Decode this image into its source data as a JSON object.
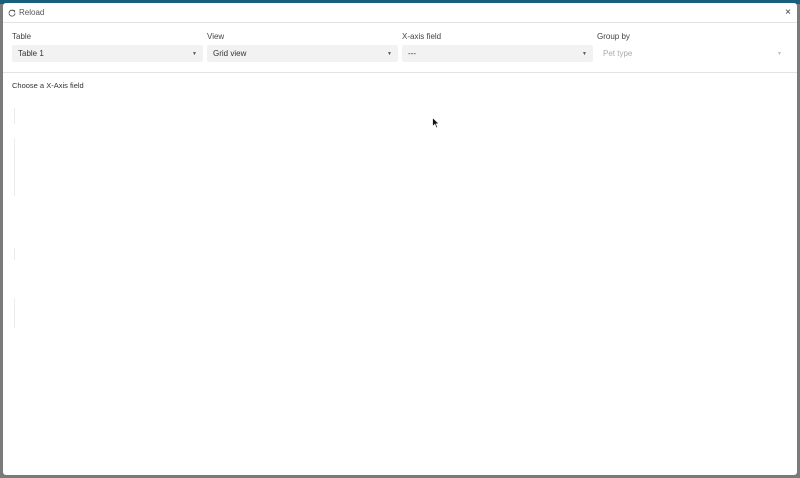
{
  "window": {
    "reload_label": "Reload",
    "close_glyph": "×"
  },
  "controls": [
    {
      "label": "Table",
      "value": "Table 1"
    },
    {
      "label": "View",
      "value": "Grid view"
    },
    {
      "label": "X-axis field",
      "value": "---"
    },
    {
      "label": "Group by",
      "value": "Pet type"
    }
  ],
  "content": {
    "message": "Choose a X-Axis field"
  },
  "icons": {
    "reload": "reload-icon",
    "close": "close-icon",
    "chevron": "chevron-down-icon",
    "cursor": "cursor-icon"
  },
  "colors": {
    "accent_strip": "#1a5e7e",
    "select_bg": "#f2f2f2",
    "backdrop": "#7a7a7a"
  }
}
